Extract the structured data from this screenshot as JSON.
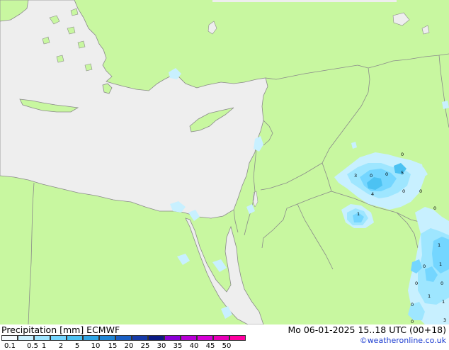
{
  "footer": {
    "title": "Precipitation [mm] ECMWF",
    "valid": "Mo 06-01-2025 15..18 UTC (00+18)",
    "credit": "©weatheronline.co.uk"
  },
  "legend": {
    "ticks": [
      "0.1",
      "0.5",
      "1",
      "2",
      "5",
      "10",
      "15",
      "20",
      "25",
      "30",
      "35",
      "40",
      "45",
      "50"
    ],
    "colors": [
      "#f4fbff",
      "#c8f0ff",
      "#9ee6ff",
      "#74d6ff",
      "#4cc2f2",
      "#2fa6e6",
      "#1f86d6",
      "#1a5fc4",
      "#163aa8",
      "#0a1a84",
      "#8a00d6",
      "#b800d6",
      "#d600d6",
      "#e800b8",
      "#ff00a0"
    ]
  },
  "map": {
    "colors": {
      "land": "#c8f7a0",
      "sea": "#eeeeee",
      "border": "#8a8a8a",
      "coast": "#8a8a8a"
    },
    "point_labels": [
      "0",
      "3",
      "0",
      "0",
      "5",
      "4",
      "0",
      "0",
      "1",
      "0",
      "1",
      "0",
      "1",
      "0",
      "1",
      "0",
      "0",
      "3",
      "0",
      "1"
    ]
  }
}
